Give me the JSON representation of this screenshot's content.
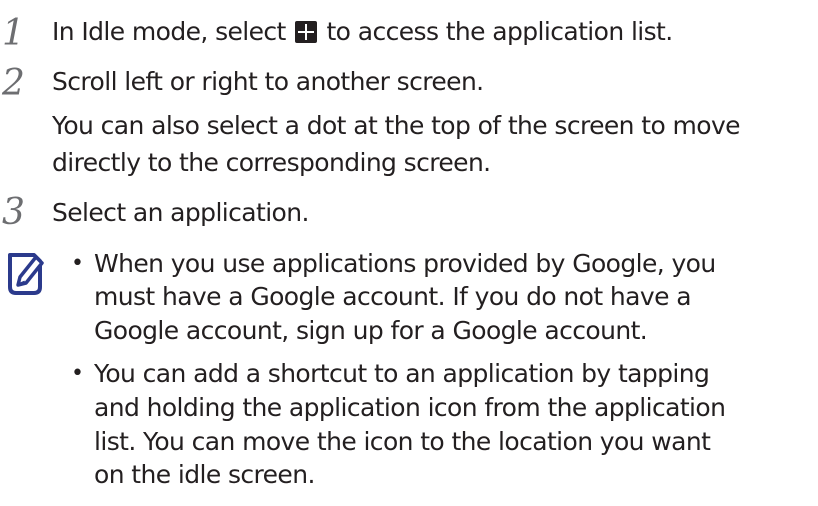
{
  "steps": [
    {
      "number": "1",
      "lines": {
        "before_icon": "In Idle mode, select",
        "after_icon": "to access the application list."
      }
    },
    {
      "number": "2",
      "lines": [
        "Scroll left or right to another screen.",
        "You can also select a dot at the top of the screen to move",
        "directly to the corresponding screen."
      ]
    },
    {
      "number": "3",
      "lines": [
        "Select an application."
      ]
    }
  ],
  "note": {
    "icon": "note-pencil-icon",
    "bullets": [
      {
        "marker": "•",
        "lines": [
          "When you use applications provided by Google, you",
          "must have a Google account. If you do not have a",
          "Google account, sign up for a Google account."
        ]
      },
      {
        "marker": "•",
        "lines": [
          "You can add a shortcut to an application by tapping",
          "and holding the application icon from the application",
          "list. You can move the icon to the location you want",
          "on the idle screen."
        ]
      }
    ]
  },
  "inline_icon": "application-grid-icon"
}
